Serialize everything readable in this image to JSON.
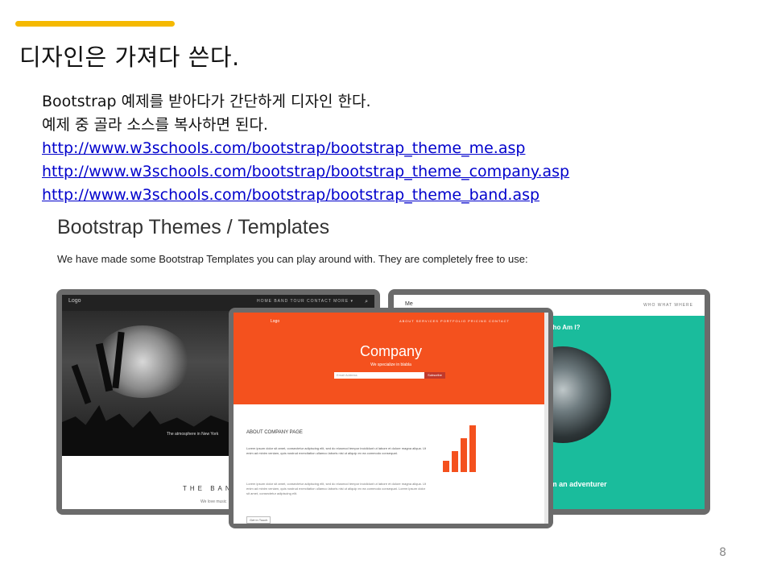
{
  "slide": {
    "title": "디자인은 가져다 쓴다.",
    "lines": [
      "Bootstrap  예제를 받아다가 간단하게 디자인 한다.",
      "예제 중 골라 소스를   복사하면 된다."
    ],
    "links": [
      "http://www.w3schools.com/bootstrap/bootstrap_theme_me.asp",
      "http://www.w3schools.com/bootstrap/bootstrap_theme_company.asp",
      "http://www.w3schools.com/bootstrap/bootstrap_theme_band.asp"
    ],
    "page_number": "8",
    "accent_color": "#f5b900"
  },
  "screenshot": {
    "title": "Bootstrap Themes / Templates",
    "subtitle": "We have made some Bootstrap Templates you can play around with. They are completely free to use:",
    "band_theme": {
      "logo": "Logo",
      "nav": "HOME   BAND   TOUR   CONTACT   MORE ▾",
      "search_icon": "search-icon",
      "caption": "The atmosphere in New York",
      "band_title": "THE BAND",
      "band_sub": "We love music"
    },
    "me_theme": {
      "logo": "Me",
      "nav": "WHO   WHAT   WHERE",
      "question": "Who Am I?",
      "name": "I'm an adventurer"
    },
    "company_theme": {
      "logo": "Logo",
      "nav": "ABOUT   SERVICES   PORTFOLIO   PRICING   CONTACT",
      "title": "Company",
      "tagline": "We specialize in blabla",
      "email_placeholder": "Email Address",
      "subscribe": "Subscribe",
      "about": "ABOUT COMPANY PAGE",
      "lorem1": "Lorem ipsum dolor sit amet, consectetur adipiscing elit, sed do eiusmod tempor incididunt ut labore et dolore magna aliqua. Ut enim ad minim veniam, quis nostrud exercitation ullamco laboris nisi ut aliquip ex ea commodo consequat.",
      "lorem2": "Lorem ipsum dolor sit amet, consectetur adipiscing elit, sed do eiusmod tempor incididunt ut labore et dolore magna aliqua. Ut enim ad minim veniam, quis nostrud exercitation ullamco laboris nisi ut aliquip ex ea commodo consequat. Lorem ipsum dolor sit amet, consectetur adipiscing elit.",
      "button": "Get in Touch",
      "accent_color": "#f4511e"
    }
  }
}
